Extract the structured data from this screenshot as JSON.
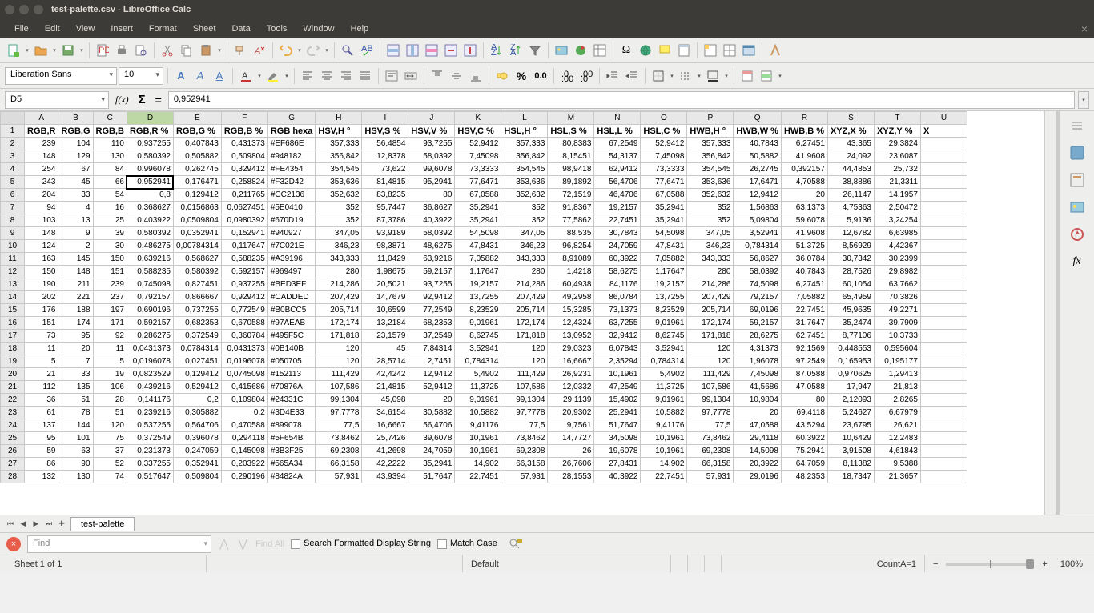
{
  "window": {
    "title": "test-palette.csv - LibreOffice Calc"
  },
  "menu": {
    "items": [
      "File",
      "Edit",
      "View",
      "Insert",
      "Format",
      "Sheet",
      "Data",
      "Tools",
      "Window",
      "Help"
    ]
  },
  "font": {
    "name": "Liberation Sans",
    "size": "10"
  },
  "cellref": {
    "name": "D5",
    "formula": "0,952941"
  },
  "sheet": {
    "tab": "test-palette"
  },
  "find": {
    "placeholder": "Find",
    "all": "Find All",
    "formatted": "Search Formatted Display String",
    "matchcase": "Match Case"
  },
  "status": {
    "sheet": "Sheet 1 of 1",
    "style": "Default",
    "count": "CountA=1",
    "zoom": "100%"
  },
  "chart_data": {
    "type": "table",
    "columns": [
      "RGB,R",
      "RGB,G",
      "RGB,B",
      "RGB,R %",
      "RGB,G %",
      "RGB,B %",
      "RGB hexa",
      "HSV,H °",
      "HSV,S %",
      "HSV,V %",
      "HSV,C %",
      "HSL,H °",
      "HSL,S %",
      "HSL,L %",
      "HSL,C %",
      "HWB,H °",
      "HWB,W %",
      "HWB,B %",
      "XYZ,X %",
      "XYZ,Y %",
      "X"
    ],
    "rows": [
      [
        "239",
        "104",
        "110",
        "0,937255",
        "0,407843",
        "0,431373",
        "#EF686E",
        "357,333",
        "56,4854",
        "93,7255",
        "52,9412",
        "357,333",
        "80,8383",
        "67,2549",
        "52,9412",
        "357,333",
        "40,7843",
        "6,27451",
        "43,365",
        "29,3824",
        ""
      ],
      [
        "148",
        "129",
        "130",
        "0,580392",
        "0,505882",
        "0,509804",
        "#948182",
        "356,842",
        "12,8378",
        "58,0392",
        "7,45098",
        "356,842",
        "8,15451",
        "54,3137",
        "7,45098",
        "356,842",
        "50,5882",
        "41,9608",
        "24,092",
        "23,6087",
        ""
      ],
      [
        "254",
        "67",
        "84",
        "0,996078",
        "0,262745",
        "0,329412",
        "#FE4354",
        "354,545",
        "73,622",
        "99,6078",
        "73,3333",
        "354,545",
        "98,9418",
        "62,9412",
        "73,3333",
        "354,545",
        "26,2745",
        "0,392157",
        "44,4853",
        "25,732",
        ""
      ],
      [
        "243",
        "45",
        "66",
        "0,952941",
        "0,176471",
        "0,258824",
        "#F32D42",
        "353,636",
        "81,4815",
        "95,2941",
        "77,6471",
        "353,636",
        "89,1892",
        "56,4706",
        "77,6471",
        "353,636",
        "17,6471",
        "4,70588",
        "38,8886",
        "21,3311",
        ""
      ],
      [
        "204",
        "33",
        "54",
        "0,8",
        "0,129412",
        "0,211765",
        "#CC2136",
        "352,632",
        "83,8235",
        "80",
        "67,0588",
        "352,632",
        "72,1519",
        "46,4706",
        "67,0588",
        "352,632",
        "12,9412",
        "20",
        "26,1147",
        "14,1957",
        ""
      ],
      [
        "94",
        "4",
        "16",
        "0,368627",
        "0,0156863",
        "0,0627451",
        "#5E0410",
        "352",
        "95,7447",
        "36,8627",
        "35,2941",
        "352",
        "91,8367",
        "19,2157",
        "35,2941",
        "352",
        "1,56863",
        "63,1373",
        "4,75363",
        "2,50472",
        ""
      ],
      [
        "103",
        "13",
        "25",
        "0,403922",
        "0,0509804",
        "0,0980392",
        "#670D19",
        "352",
        "87,3786",
        "40,3922",
        "35,2941",
        "352",
        "77,5862",
        "22,7451",
        "35,2941",
        "352",
        "5,09804",
        "59,6078",
        "5,9136",
        "3,24254",
        ""
      ],
      [
        "148",
        "9",
        "39",
        "0,580392",
        "0,0352941",
        "0,152941",
        "#940927",
        "347,05",
        "93,9189",
        "58,0392",
        "54,5098",
        "347,05",
        "88,535",
        "30,7843",
        "54,5098",
        "347,05",
        "3,52941",
        "41,9608",
        "12,6782",
        "6,63985",
        ""
      ],
      [
        "124",
        "2",
        "30",
        "0,486275",
        "0,00784314",
        "0,117647",
        "#7C021E",
        "346,23",
        "98,3871",
        "48,6275",
        "47,8431",
        "346,23",
        "96,8254",
        "24,7059",
        "47,8431",
        "346,23",
        "0,784314",
        "51,3725",
        "8,56929",
        "4,42367",
        ""
      ],
      [
        "163",
        "145",
        "150",
        "0,639216",
        "0,568627",
        "0,588235",
        "#A39196",
        "343,333",
        "11,0429",
        "63,9216",
        "7,05882",
        "343,333",
        "8,91089",
        "60,3922",
        "7,05882",
        "343,333",
        "56,8627",
        "36,0784",
        "30,7342",
        "30,2399",
        ""
      ],
      [
        "150",
        "148",
        "151",
        "0,588235",
        "0,580392",
        "0,592157",
        "#969497",
        "280",
        "1,98675",
        "59,2157",
        "1,17647",
        "280",
        "1,4218",
        "58,6275",
        "1,17647",
        "280",
        "58,0392",
        "40,7843",
        "28,7526",
        "29,8982",
        ""
      ],
      [
        "190",
        "211",
        "239",
        "0,745098",
        "0,827451",
        "0,937255",
        "#BED3EF",
        "214,286",
        "20,5021",
        "93,7255",
        "19,2157",
        "214,286",
        "60,4938",
        "84,1176",
        "19,2157",
        "214,286",
        "74,5098",
        "6,27451",
        "60,1054",
        "63,7662",
        ""
      ],
      [
        "202",
        "221",
        "237",
        "0,792157",
        "0,866667",
        "0,929412",
        "#CADDED",
        "207,429",
        "14,7679",
        "92,9412",
        "13,7255",
        "207,429",
        "49,2958",
        "86,0784",
        "13,7255",
        "207,429",
        "79,2157",
        "7,05882",
        "65,4959",
        "70,3826",
        ""
      ],
      [
        "176",
        "188",
        "197",
        "0,690196",
        "0,737255",
        "0,772549",
        "#B0BCC5",
        "205,714",
        "10,6599",
        "77,2549",
        "8,23529",
        "205,714",
        "15,3285",
        "73,1373",
        "8,23529",
        "205,714",
        "69,0196",
        "22,7451",
        "45,9635",
        "49,2271",
        ""
      ],
      [
        "151",
        "174",
        "171",
        "0,592157",
        "0,682353",
        "0,670588",
        "#97AEAB",
        "172,174",
        "13,2184",
        "68,2353",
        "9,01961",
        "172,174",
        "12,4324",
        "63,7255",
        "9,01961",
        "172,174",
        "59,2157",
        "31,7647",
        "35,2474",
        "39,7909",
        ""
      ],
      [
        "73",
        "95",
        "92",
        "0,286275",
        "0,372549",
        "0,360784",
        "#495F5C",
        "171,818",
        "23,1579",
        "37,2549",
        "8,62745",
        "171,818",
        "13,0952",
        "32,9412",
        "8,62745",
        "171,818",
        "28,6275",
        "62,7451",
        "8,77106",
        "10,3733",
        ""
      ],
      [
        "11",
        "20",
        "11",
        "0,0431373",
        "0,0784314",
        "0,0431373",
        "#0B140B",
        "120",
        "45",
        "7,84314",
        "3,52941",
        "120",
        "29,0323",
        "6,07843",
        "3,52941",
        "120",
        "4,31373",
        "92,1569",
        "0,448553",
        "0,595604",
        ""
      ],
      [
        "5",
        "7",
        "5",
        "0,0196078",
        "0,027451",
        "0,0196078",
        "#050705",
        "120",
        "28,5714",
        "2,7451",
        "0,784314",
        "120",
        "16,6667",
        "2,35294",
        "0,784314",
        "120",
        "1,96078",
        "97,2549",
        "0,165953",
        "0,195177",
        ""
      ],
      [
        "21",
        "33",
        "19",
        "0,0823529",
        "0,129412",
        "0,0745098",
        "#152113",
        "111,429",
        "42,4242",
        "12,9412",
        "5,4902",
        "111,429",
        "26,9231",
        "10,1961",
        "5,4902",
        "111,429",
        "7,45098",
        "87,0588",
        "0,970625",
        "1,29413",
        ""
      ],
      [
        "112",
        "135",
        "106",
        "0,439216",
        "0,529412",
        "0,415686",
        "#70876A",
        "107,586",
        "21,4815",
        "52,9412",
        "11,3725",
        "107,586",
        "12,0332",
        "47,2549",
        "11,3725",
        "107,586",
        "41,5686",
        "47,0588",
        "17,947",
        "21,813",
        ""
      ],
      [
        "36",
        "51",
        "28",
        "0,141176",
        "0,2",
        "0,109804",
        "#24331C",
        "99,1304",
        "45,098",
        "20",
        "9,01961",
        "99,1304",
        "29,1139",
        "15,4902",
        "9,01961",
        "99,1304",
        "10,9804",
        "80",
        "2,12093",
        "2,8265",
        ""
      ],
      [
        "61",
        "78",
        "51",
        "0,239216",
        "0,305882",
        "0,2",
        "#3D4E33",
        "97,7778",
        "34,6154",
        "30,5882",
        "10,5882",
        "97,7778",
        "20,9302",
        "25,2941",
        "10,5882",
        "97,7778",
        "20",
        "69,4118",
        "5,24627",
        "6,67979",
        ""
      ],
      [
        "137",
        "144",
        "120",
        "0,537255",
        "0,564706",
        "0,470588",
        "#899078",
        "77,5",
        "16,6667",
        "56,4706",
        "9,41176",
        "77,5",
        "9,7561",
        "51,7647",
        "9,41176",
        "77,5",
        "47,0588",
        "43,5294",
        "23,6795",
        "26,621",
        ""
      ],
      [
        "95",
        "101",
        "75",
        "0,372549",
        "0,396078",
        "0,294118",
        "#5F654B",
        "73,8462",
        "25,7426",
        "39,6078",
        "10,1961",
        "73,8462",
        "14,7727",
        "34,5098",
        "10,1961",
        "73,8462",
        "29,4118",
        "60,3922",
        "10,6429",
        "12,2483",
        ""
      ],
      [
        "59",
        "63",
        "37",
        "0,231373",
        "0,247059",
        "0,145098",
        "#3B3F25",
        "69,2308",
        "41,2698",
        "24,7059",
        "10,1961",
        "69,2308",
        "26",
        "19,6078",
        "10,1961",
        "69,2308",
        "14,5098",
        "75,2941",
        "3,91508",
        "4,61843",
        ""
      ],
      [
        "86",
        "90",
        "52",
        "0,337255",
        "0,352941",
        "0,203922",
        "#565A34",
        "66,3158",
        "42,2222",
        "35,2941",
        "14,902",
        "66,3158",
        "26,7606",
        "27,8431",
        "14,902",
        "66,3158",
        "20,3922",
        "64,7059",
        "8,11382",
        "9,5388",
        ""
      ],
      [
        "132",
        "130",
        "74",
        "0,517647",
        "0,509804",
        "0,290196",
        "#84824A",
        "57,931",
        "43,9394",
        "51,7647",
        "22,7451",
        "57,931",
        "28,1553",
        "40,3922",
        "22,7451",
        "57,931",
        "29,0196",
        "48,2353",
        "18,7347",
        "21,3657",
        ""
      ]
    ]
  }
}
